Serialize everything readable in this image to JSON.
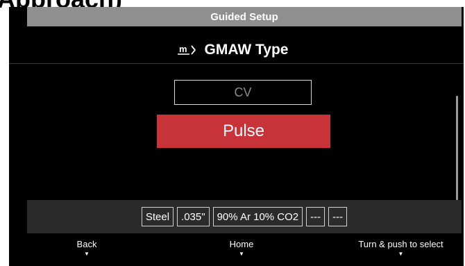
{
  "top_cropped_text": "Approach)",
  "title_bar": {
    "title": "Guided Setup"
  },
  "header": {
    "icon": "m-menu-icon",
    "icon_glyph": "m",
    "title": "GMAW Type"
  },
  "options": [
    {
      "label": "CV",
      "selected": false
    },
    {
      "label": "Pulse",
      "selected": true
    }
  ],
  "summary_chips": [
    "Steel",
    ".035\"",
    "90% Ar 10% CO2",
    "---",
    "---"
  ],
  "footer": {
    "back_label": "Back",
    "home_label": "Home",
    "select_label": "Turn & push to select",
    "caret": "▼"
  },
  "colors": {
    "accent_red": "#c8333a",
    "title_bar_gray": "#8f8f8f",
    "screen_black": "#000000"
  }
}
